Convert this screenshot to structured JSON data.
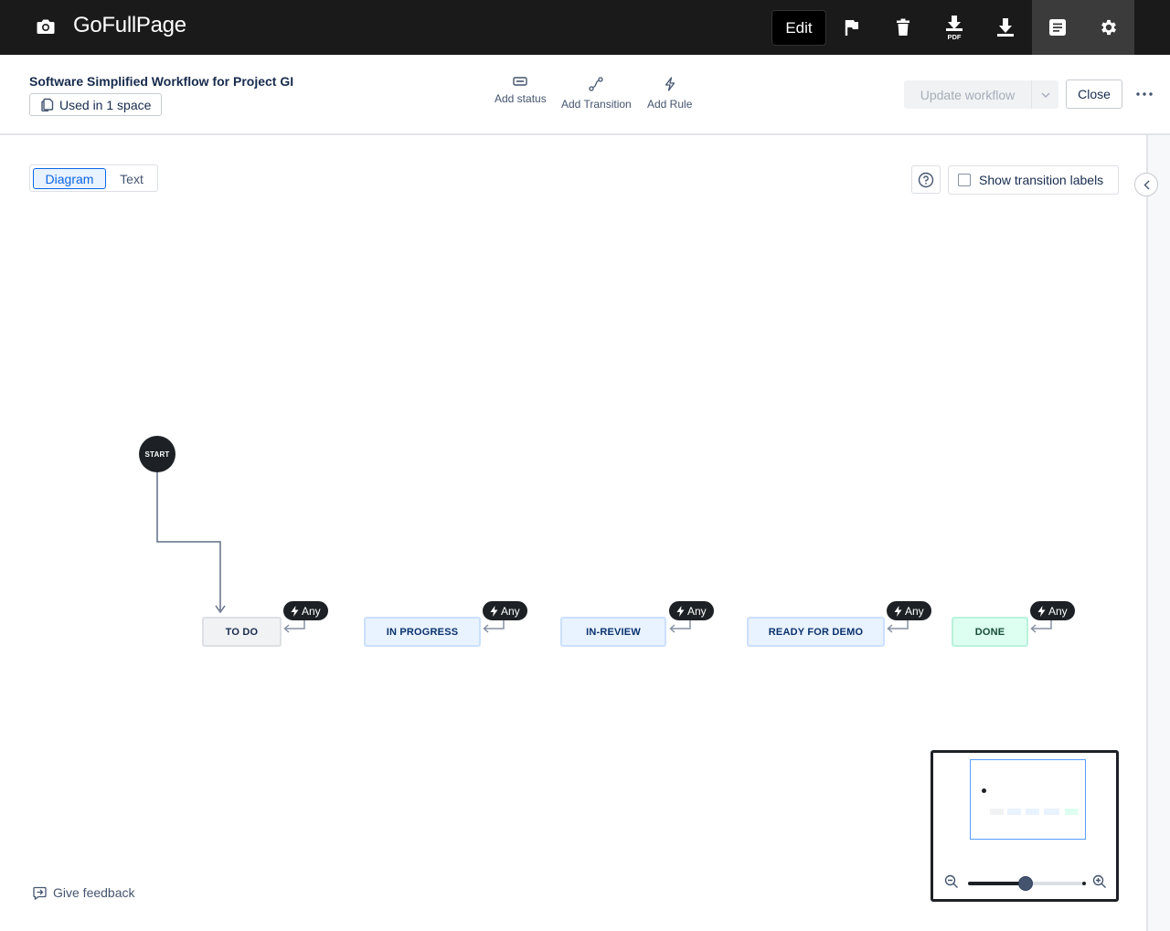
{
  "app": {
    "brand": "GoFullPage"
  },
  "topbar": {
    "edit_label": "Edit",
    "icons": [
      "flag-icon",
      "trash-icon",
      "download-pdf-icon",
      "download-icon",
      "document-icon",
      "gear-icon"
    ],
    "pdf_label": "PDF"
  },
  "header": {
    "title": "Software Simplified Workflow for Project GI",
    "used_in": "Used in 1 space",
    "tools": {
      "add_status": "Add status",
      "add_transition": "Add Transition",
      "add_rule": "Add Rule"
    },
    "update_label": "Update workflow",
    "close_label": "Close"
  },
  "view_toggle": {
    "diagram": "Diagram",
    "text": "Text",
    "selected": "Diagram"
  },
  "transition_labels": {
    "label": "Show transition labels",
    "checked": false
  },
  "diagram": {
    "start_label": "START",
    "any_label": "Any",
    "statuses": [
      {
        "name": "TO DO",
        "category": "todo"
      },
      {
        "name": "IN PROGRESS",
        "category": "in-progress"
      },
      {
        "name": "IN-REVIEW",
        "category": "in-progress"
      },
      {
        "name": "READY FOR DEMO",
        "category": "in-progress"
      },
      {
        "name": "DONE",
        "category": "done"
      }
    ]
  },
  "minimap": {
    "zoom_level": 0.5
  },
  "feedback": {
    "label": "Give feedback"
  },
  "colors": {
    "topbar": "#1a1a1a",
    "accent": "#0c66e4",
    "done": "#dcfff1",
    "in_progress": "#e9f2ff",
    "todo": "#f1f2f4"
  }
}
